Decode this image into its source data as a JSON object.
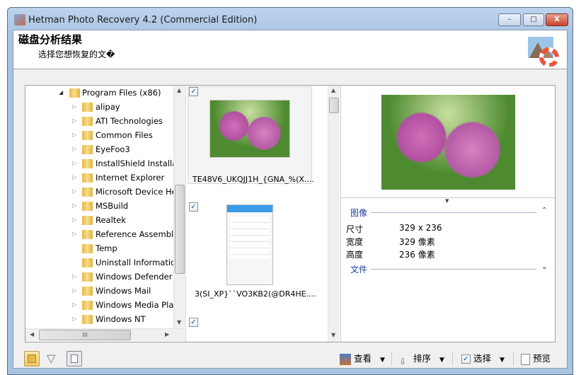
{
  "window": {
    "title": "Hetman Photo Recovery 4.2 (Commercial Edition)",
    "minimize": "–",
    "maximize": "□",
    "close": "X"
  },
  "header": {
    "title": "磁盘分析结果",
    "subtitle": "选择您想恢复的文�"
  },
  "tree": {
    "root": "Program Files (x86)",
    "items": [
      {
        "label": "alipay",
        "expandable": true
      },
      {
        "label": "ATI Technologies",
        "expandable": true
      },
      {
        "label": "Common Files",
        "expandable": true
      },
      {
        "label": "EyeFoo3",
        "expandable": true
      },
      {
        "label": "InstallShield Installation",
        "expandable": true
      },
      {
        "label": "Internet Explorer",
        "expandable": true
      },
      {
        "label": "Microsoft Device Health",
        "expandable": true
      },
      {
        "label": "MSBuild",
        "expandable": true
      },
      {
        "label": "Realtek",
        "expandable": true
      },
      {
        "label": "Reference Assemblies",
        "expandable": true
      },
      {
        "label": "Temp",
        "expandable": false
      },
      {
        "label": "Uninstall Information",
        "expandable": false
      },
      {
        "label": "Windows Defender",
        "expandable": true
      },
      {
        "label": "Windows Mail",
        "expandable": true
      },
      {
        "label": "Windows Media Player",
        "expandable": true
      },
      {
        "label": "Windows NT",
        "expandable": true
      }
    ],
    "hscroll_grip": "III"
  },
  "thumbnails": [
    {
      "name": "TE48V6_UKQJJ1H_{GNA_%(X....",
      "checked": true,
      "selected": true
    },
    {
      "name": "3(SI_XP}``VO3KB2(@DR4HE....",
      "checked": true,
      "selected": false
    },
    {
      "name": "",
      "checked": true,
      "selected": false
    }
  ],
  "details": {
    "image_section": "图像",
    "file_section": "文件",
    "rows": [
      {
        "label": "尺寸",
        "value": "329 x 236"
      },
      {
        "label": "宽度",
        "value": "329 像素"
      },
      {
        "label": "高度",
        "value": "236 像素"
      }
    ]
  },
  "toolbar": {
    "view": "查看",
    "sort": "排序",
    "select": "选择",
    "preview": "预览"
  },
  "colors": {
    "accent": "#1e3f9a",
    "frame": "#a9c4e2"
  }
}
